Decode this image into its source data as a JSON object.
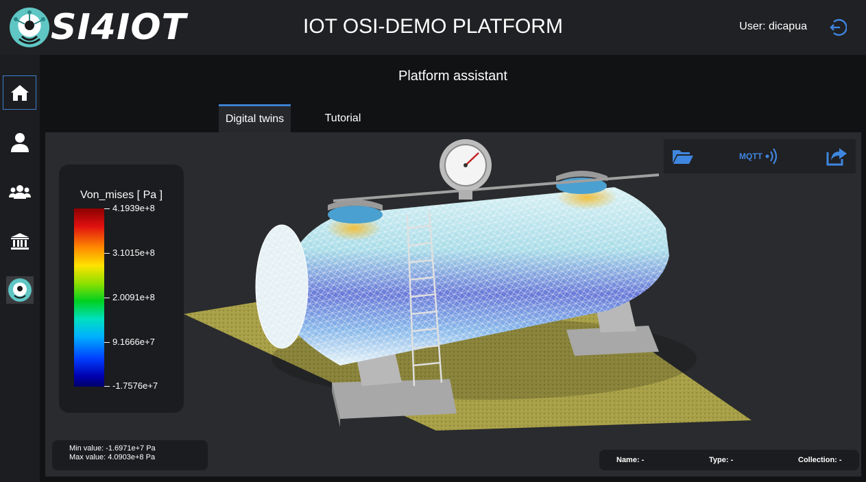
{
  "header": {
    "logo_text": "SI4IOT",
    "title": "IOT OSI-DEMO PLATFORM",
    "user_label": "User: dicapua"
  },
  "sidebar": {
    "items": [
      {
        "name": "home",
        "icon": "home-icon",
        "active": true
      },
      {
        "name": "user",
        "icon": "user-icon",
        "active": false
      },
      {
        "name": "users",
        "icon": "users-icon",
        "active": false
      },
      {
        "name": "institution",
        "icon": "institution-icon",
        "active": false
      },
      {
        "name": "si4iot",
        "icon": "si4iot-logo-icon",
        "active": false
      }
    ]
  },
  "main": {
    "title": "Platform assistant",
    "tabs": [
      {
        "label": "Digital twins",
        "active": true
      },
      {
        "label": "Tutorial",
        "active": false
      }
    ]
  },
  "legend": {
    "title": "Von_mises [ Pa ]",
    "labels": [
      "4.1939e+8",
      "3.1015e+8",
      "2.0091e+8",
      "9.1666e+7",
      "-1.7576e+7"
    ]
  },
  "toolbar": {
    "open_icon": "folder-open-icon",
    "mqtt_label": "MQTT",
    "mqtt_icon": "signal-waves-icon",
    "share_icon": "share-icon"
  },
  "stats": {
    "min": "Min value: -1.6971e+7 Pa",
    "max": "Max value: 4.0903e+8 Pa"
  },
  "info": {
    "name": "Name: -",
    "type": "Type: -",
    "collection": "Collection: -"
  },
  "colors": {
    "accent": "#3f7fd0",
    "header_bg": "#202124",
    "viewport_bg": "#2a2b2e"
  }
}
